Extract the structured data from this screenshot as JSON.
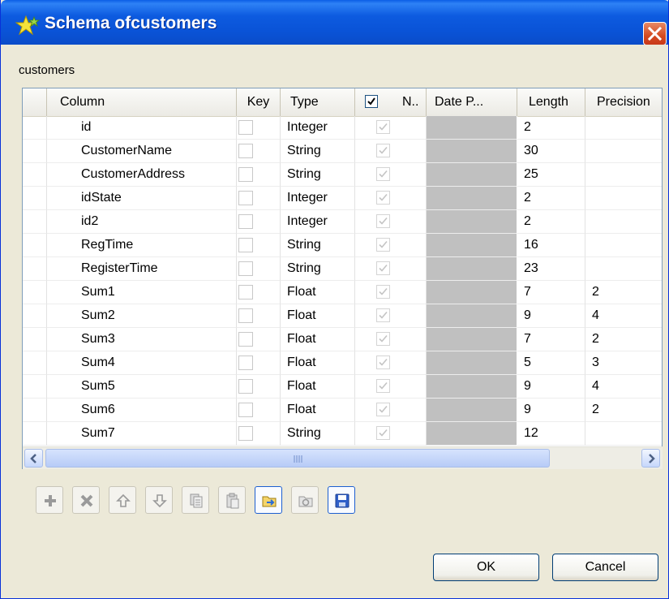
{
  "window": {
    "title": "Schema ofcustomers"
  },
  "schema_name": "customers",
  "columns": {
    "column": "Column",
    "key": "Key",
    "type": "Type",
    "nullable": "N..",
    "date_pattern": "Date P...",
    "length": "Length",
    "precision": "Precision"
  },
  "rows": [
    {
      "column": "id",
      "type": "Integer",
      "length": "2",
      "precision": ""
    },
    {
      "column": "CustomerName",
      "type": "String",
      "length": "30",
      "precision": ""
    },
    {
      "column": "CustomerAddress",
      "type": "String",
      "length": "25",
      "precision": ""
    },
    {
      "column": "idState",
      "type": "Integer",
      "length": "2",
      "precision": ""
    },
    {
      "column": "id2",
      "type": "Integer",
      "length": "2",
      "precision": ""
    },
    {
      "column": "RegTime",
      "type": "String",
      "length": "16",
      "precision": ""
    },
    {
      "column": "RegisterTime",
      "type": "String",
      "length": "23",
      "precision": ""
    },
    {
      "column": "Sum1",
      "type": "Float",
      "length": "7",
      "precision": "2"
    },
    {
      "column": "Sum2",
      "type": "Float",
      "length": "9",
      "precision": "4"
    },
    {
      "column": "Sum3",
      "type": "Float",
      "length": "7",
      "precision": "2"
    },
    {
      "column": "Sum4",
      "type": "Float",
      "length": "5",
      "precision": "3"
    },
    {
      "column": "Sum5",
      "type": "Float",
      "length": "9",
      "precision": "4"
    },
    {
      "column": "Sum6",
      "type": "Float",
      "length": "9",
      "precision": "2"
    },
    {
      "column": "Sum7",
      "type": "String",
      "length": "12",
      "precision": ""
    }
  ],
  "toolbar": {
    "icons": [
      "add-icon",
      "remove-icon",
      "move-up-icon",
      "move-down-icon",
      "copy-icon",
      "paste-icon",
      "import-icon",
      "export-icon",
      "save-icon"
    ]
  },
  "buttons": {
    "ok": "OK",
    "cancel": "Cancel"
  },
  "colors": {
    "title_bar": "#0a53d7",
    "date_cell": "#c0c0c0",
    "accent": "#1d5fd0"
  }
}
